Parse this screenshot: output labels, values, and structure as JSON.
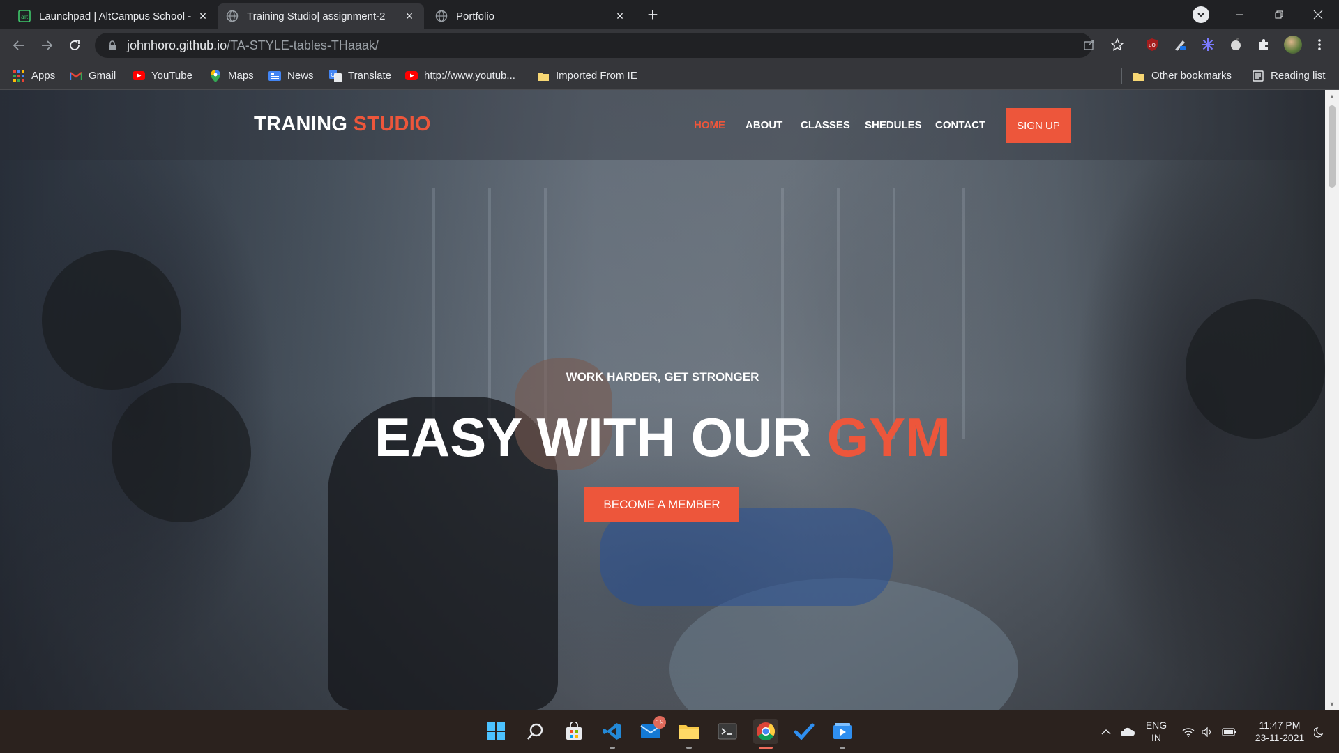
{
  "browser": {
    "tabs": [
      {
        "title": "Launchpad | AltCampus School -",
        "favicon": "altcampus-icon"
      },
      {
        "title": "Training Studio| assignment-2",
        "favicon": "globe-icon",
        "active": true
      },
      {
        "title": "Portfolio",
        "favicon": "globe-icon"
      }
    ],
    "url_host": "johnhoro.github.io",
    "url_path": "/TA-STYLE-tables-THaaak/",
    "bookmarks": [
      {
        "label": "Apps",
        "icon": "apps-grid-icon"
      },
      {
        "label": "Gmail",
        "icon": "gmail-icon"
      },
      {
        "label": "YouTube",
        "icon": "youtube-icon"
      },
      {
        "label": "Maps",
        "icon": "maps-pin-icon"
      },
      {
        "label": "News",
        "icon": "news-icon"
      },
      {
        "label": "Translate",
        "icon": "translate-icon"
      },
      {
        "label": "http://www.youtub...",
        "icon": "youtube-icon"
      },
      {
        "label": "Imported From IE",
        "icon": "folder-icon"
      }
    ],
    "other_bookmarks": "Other bookmarks",
    "reading_list": "Reading list"
  },
  "site": {
    "logo_main": "TRANING",
    "logo_accent": "STUDIO",
    "nav": [
      "HOME",
      "ABOUT",
      "CLASSES",
      "SHEDULES",
      "CONTACT"
    ],
    "signup": "SIGN UP",
    "hero_subtitle": "WORK HARDER, GET STRONGER",
    "hero_title_main": "EASY WITH OUR",
    "hero_title_accent": "GYM",
    "cta": "BECOME A MEMBER"
  },
  "taskbar": {
    "mail_badge": "19",
    "lang_line1": "ENG",
    "lang_line2": "IN",
    "time": "11:47 PM",
    "date": "23-11-2021"
  },
  "colors": {
    "accent": "#ed563b",
    "browser_frame": "#202124",
    "browser_toolbar": "#35363a"
  }
}
